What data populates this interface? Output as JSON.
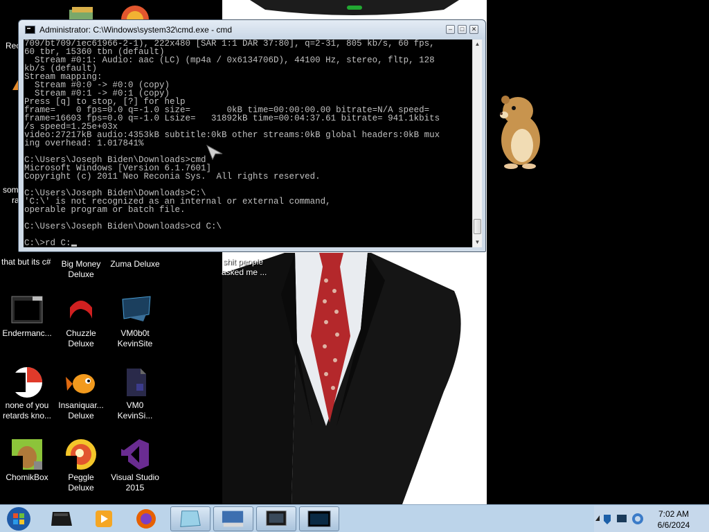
{
  "cmd_window": {
    "title": "Administrator: C:\\Windows\\system32\\cmd.exe - cmd",
    "buttons": {
      "minimize": "–",
      "maximize": "□",
      "close": "✕"
    },
    "lines": [
      "709/bt709/iec61966-2-1), 222x480 [SAR 1:1 DAR 37:80], q=2-31, 805 kb/s, 60 fps,",
      "60 tbr, 15360 tbn (default)",
      "  Stream #0:1: Audio: aac (LC) (mp4a / 0x6134706D), 44100 Hz, stereo, fltp, 128",
      "kb/s (default)",
      "Stream mapping:",
      "  Stream #0:0 -> #0:0 (copy)",
      "  Stream #0:1 -> #0:1 (copy)",
      "Press [q] to stop, [?] for help",
      "frame=    0 fps=0.0 q=-1.0 size=       0kB time=00:00:00.00 bitrate=N/A speed=",
      "frame=16603 fps=0.0 q=-1.0 Lsize=   31892kB time=00:04:37.61 bitrate= 941.1kbits",
      "/s speed=1.25e+03x",
      "video:27217kB audio:4353kB subtitle:0kB other streams:0kB global headers:0kB mux",
      "ing overhead: 1.017841%",
      "",
      "C:\\Users\\Joseph Biden\\Downloads>cmd",
      "Microsoft Windows [Version 6.1.7601]",
      "Copyright (c) 2011 Neo Reconia Sys.  All rights reserved.",
      "",
      "C:\\Users\\Joseph Biden\\Downloads>C:\\",
      "'C:\\' is not recognized as an internal or external command,",
      "operable program or batch file.",
      "",
      "C:\\Users\\Joseph Biden\\Downloads>cd C:\\",
      "",
      "C:\\>rd C:"
    ]
  },
  "desktop": {
    "partial_labels": {
      "top_left": "Rec",
      "mid_left_1": "som",
      "mid_left_2": "ra",
      "row1_col1": "that but its c#",
      "row1_center": "shit people",
      "row1_center_2": "asked me ..."
    },
    "icons": [
      {
        "label_1": "Big Money",
        "label_2": "Deluxe"
      },
      {
        "label_1": "Zuma Deluxe",
        "label_2": ""
      },
      {
        "label_1": "Endermanc...",
        "label_2": ""
      },
      {
        "label_1": "Chuzzle",
        "label_2": "Deluxe"
      },
      {
        "label_1": "VM0b0t",
        "label_2": "KevinSite"
      },
      {
        "label_1": "none of you",
        "label_2": "retards kno..."
      },
      {
        "label_1": "Insaniquar...",
        "label_2": "Deluxe"
      },
      {
        "label_1": "VM0",
        "label_2": "KevinSi..."
      },
      {
        "label_1": "ChomikBox",
        "label_2": ""
      },
      {
        "label_1": "Peggle Deluxe",
        "label_2": ""
      },
      {
        "label_1": "Visual Studio",
        "label_2": "2015"
      }
    ]
  },
  "taskbar": {
    "time": "7:02 AM",
    "date": "6/6/2024"
  }
}
